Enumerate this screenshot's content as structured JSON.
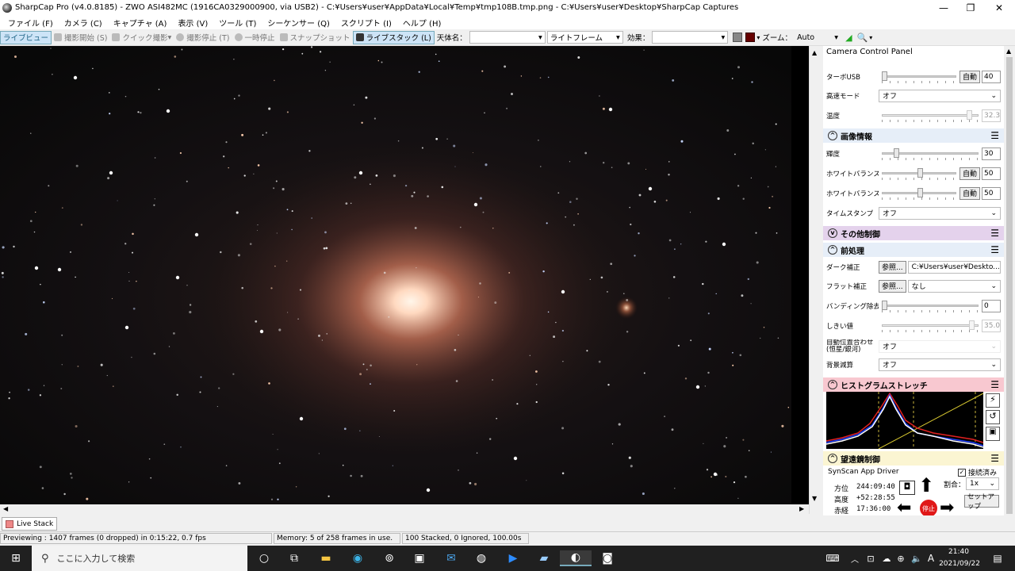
{
  "window": {
    "title": "SharpCap Pro (v4.0.8185) - ZWO ASI482MC (1916CA0329000900, via USB2) - C:¥Users¥user¥AppData¥Local¥Temp¥tmp108B.tmp.png - C:¥Users¥user¥Desktop¥SharpCap Captures",
    "minimize": "—",
    "maximize": "❐",
    "close": "✕"
  },
  "menu": [
    "ファイル (F)",
    "カメラ (C)",
    "キャプチャ (A)",
    "表示 (V)",
    "ツール (T)",
    "シーケンサー (Q)",
    "スクリプト (I)",
    "ヘルプ (H)"
  ],
  "toolbar": {
    "live_view": "ライブビュー",
    "start_capture": "撮影開始 (S)",
    "quick_capture": "クイック撮影",
    "stop_capture": "撮影停止 (T)",
    "pause": "一時停止",
    "snapshot": "スナップショット",
    "live_stack": "ライブスタック (L)",
    "target_label": "天体名：",
    "target_value": "",
    "frame_type": "ライトフレーム",
    "effect_label": "効果：",
    "effect_value": "",
    "zoom_label": "ズーム：",
    "zoom_value": "Auto"
  },
  "panel": {
    "header": "Camera Control Panel",
    "rows_top": {
      "turbo_usb_label": "ターボUSB",
      "turbo_usb_auto": "自動",
      "turbo_usb_value": "40",
      "high_speed_label": "高速モード",
      "high_speed_value": "オフ",
      "temp_label": "温度",
      "temp_value": "32.3"
    },
    "image_info": {
      "title": "画像情報",
      "brightness_label": "輝度",
      "brightness_value": "30",
      "wb_r_label": "ホワイトバランス(R)",
      "wb_r_auto": "自動",
      "wb_r_value": "50",
      "wb_b_label": "ホワイトバランス(B)",
      "wb_b_auto": "自動",
      "wb_b_value": "50",
      "timestamp_label": "タイムスタンプ",
      "timestamp_value": "オフ"
    },
    "other_controls": {
      "title": "その他制御"
    },
    "preprocess": {
      "title": "前処理",
      "dark_label": "ダーク補正",
      "dark_browse": "参照...",
      "dark_value": "C:¥Users¥user¥Deskto...",
      "flat_label": "フラット補正",
      "flat_browse": "参照...",
      "flat_value": "なし",
      "banding_label": "バンディング除去",
      "banding_value": "0",
      "threshold_label": "しきい値",
      "threshold_value": "35.0",
      "auto_align_label": "自動位置合わせ\n(恒星/銀河)",
      "auto_align_value": "オフ",
      "bg_sub_label": "背景減算",
      "bg_sub_value": "オフ"
    },
    "histogram": {
      "title": "ヒストグラムストレッチ"
    },
    "telescope": {
      "title": "望遠鏡制御",
      "driver": "SynScan App Driver",
      "connected_label": "接続済み",
      "az_label": "方位",
      "az_value": "244:09:40",
      "alt_label": "高度",
      "alt_value": "+52:28:55",
      "ra_label": "赤経",
      "ra_value": "17:36:00",
      "rate_label": "割合：",
      "rate_value": "1x",
      "setup": "セットアップ",
      "stop": "停止"
    }
  },
  "live_stack_tab": "Live Stack",
  "status": {
    "previewing": "Previewing : 1407 frames (0 dropped) in 0:15:22, 0.7 fps",
    "memory": "Memory: 5 of 258 frames in use.",
    "stacked": "100 Stacked, 0 Ignored, 100.00s"
  },
  "taskbar": {
    "search_placeholder": "ここに入力して検索",
    "time": "21:40",
    "date": "2021/09/22",
    "ime": "A"
  },
  "colors": {
    "image_info_header": "#e6eef8",
    "other_header": "#e4d2ec",
    "histogram_header": "#f8c8d0",
    "telescope_header": "#fbf5d2"
  }
}
